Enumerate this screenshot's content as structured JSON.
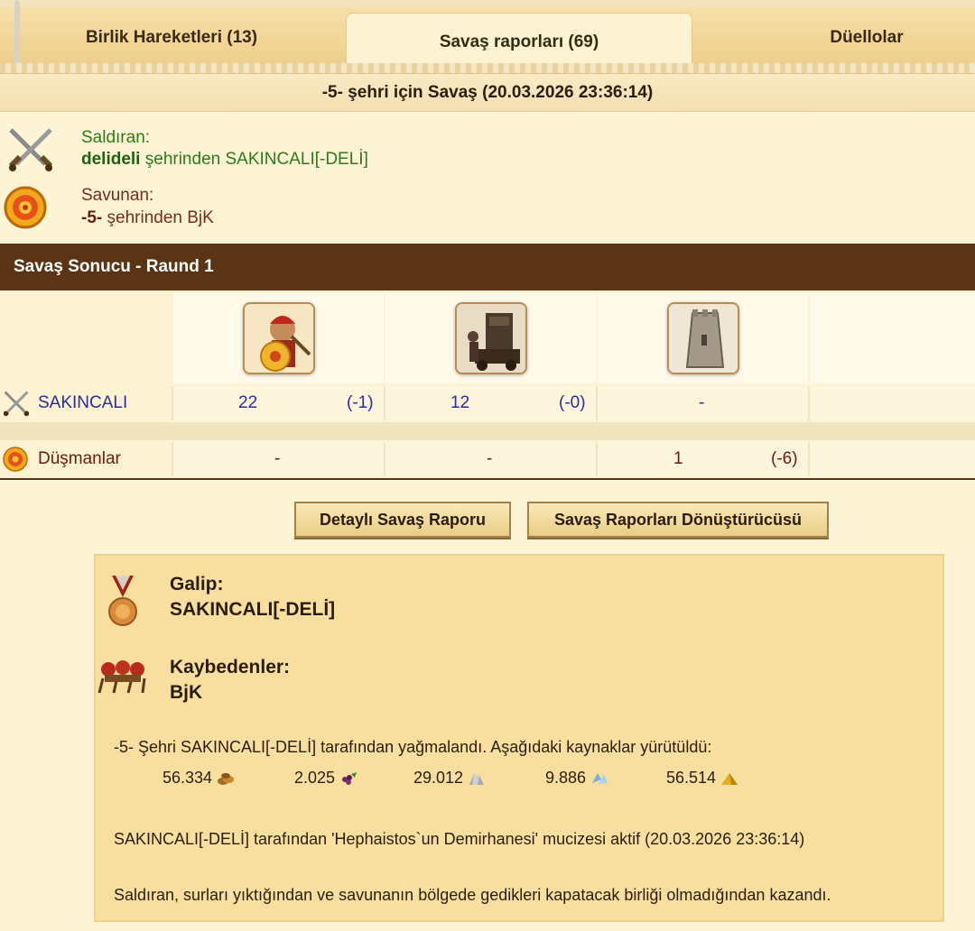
{
  "tabs": [
    {
      "label": "Birlik Hareketleri (13)"
    },
    {
      "label": "Savaş raporları (69)"
    },
    {
      "label": "Düellolar"
    }
  ],
  "report": {
    "title": "-5- şehri için Savaş (20.03.2026 23:36:14)",
    "attacker_label": "Saldıran:",
    "attacker_city": "delideli",
    "attacker_rest": " şehrinden SAKINCALI[-DELİ]",
    "defender_label": "Savunan:",
    "defender_city": "-5-",
    "defender_rest": " şehrinden BjK"
  },
  "round": {
    "title": "Savaş Sonucu - Raund 1"
  },
  "units": [
    "hoplite-unit",
    "catapult-unit",
    "wall-unit"
  ],
  "rows": [
    {
      "name": "SAKINCALI",
      "cells": [
        "22",
        "(-1)",
        "12",
        "(-0)",
        "-"
      ]
    },
    {
      "name": "Düşmanlar",
      "cells": [
        "-",
        "-",
        "1",
        "(-6)"
      ]
    }
  ],
  "buttons": {
    "detail": "Detaylı Savaş Raporu",
    "converter": "Savaş Raporları Dönüştürücüsü"
  },
  "result": {
    "winner_label": "Galip:",
    "winner_name": "SAKINCALI[-DELİ]",
    "losers_label": "Kaybedenler:",
    "losers_name": "BjK",
    "plunder_text": "-5- Şehri SAKINCALI[-DELİ] tarafından yağmalandı. Aşağıdaki kaynaklar yürütüldü:",
    "resources": [
      {
        "value": "56.334",
        "icon": "wood-icon"
      },
      {
        "value": "2.025",
        "icon": "wine-icon"
      },
      {
        "value": "29.012",
        "icon": "marble-icon"
      },
      {
        "value": "9.886",
        "icon": "crystal-icon"
      },
      {
        "value": "56.514",
        "icon": "sulfur-icon"
      }
    ],
    "wonder_text": "SAKINCALI[-DELİ] tarafından 'Hephaistos`un Demirhanesi' mucizesi aktif (20.03.2026 23:36:14)",
    "reason_text": "Saldıran, surları yıktığından ve savunanın bölgede gedikleri kapatacak birliği olmadığından kazandı."
  }
}
